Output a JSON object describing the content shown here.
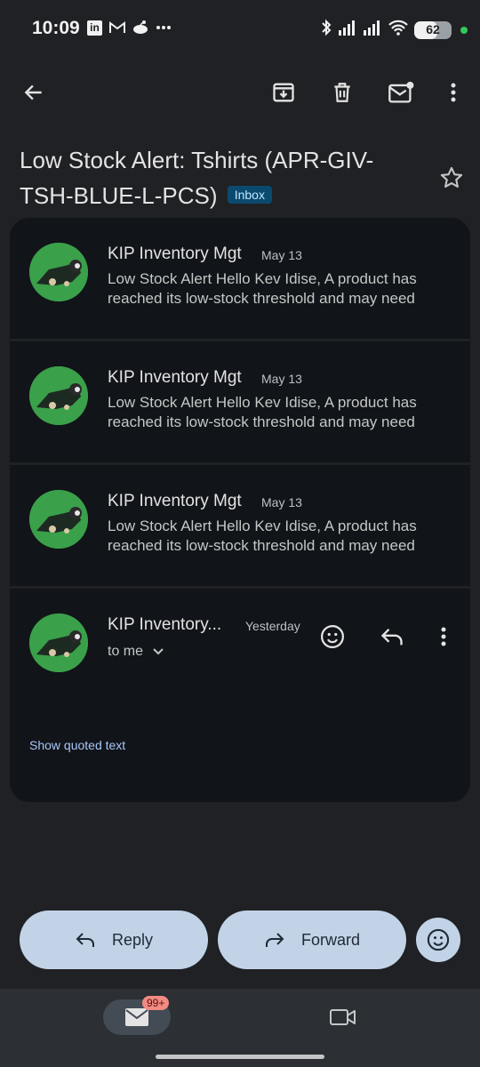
{
  "status_bar": {
    "time": "10:09",
    "left_icons": [
      "linkedin-icon",
      "gmail-icon",
      "reddit-icon",
      "more-dots-icon"
    ],
    "right_icons": [
      "bluetooth-icon",
      "signal-icon",
      "signal-icon",
      "wifi-icon"
    ],
    "battery": {
      "level_percent": 62,
      "text": "62"
    }
  },
  "toolbar": {
    "icons": [
      "back-arrow-icon",
      "archive-icon",
      "delete-icon",
      "mark-unread-icon",
      "more-vert-icon"
    ]
  },
  "subject": {
    "text": "Low Stock Alert: Tshirts (APR-GIV-TSH-BLUE-L-PCS)",
    "label": "Inbox"
  },
  "thread": {
    "collapsed": [
      {
        "sender": "KIP Inventory Mgt",
        "date": "May 13",
        "snippet": "Low Stock Alert Hello Kev Idise, A product has reached its low-stock threshold and may need"
      },
      {
        "sender": "KIP Inventory Mgt",
        "date": "May 13",
        "snippet": "Low Stock Alert Hello Kev Idise, A product has reached its low-stock threshold and may need"
      },
      {
        "sender": "KIP Inventory Mgt",
        "date": "May 13",
        "snippet": "Low Stock Alert Hello Kev Idise, A product has reached its low-stock threshold and may need"
      }
    ],
    "expanded": {
      "sender": "KIP Inventory...",
      "date": "Yesterday",
      "recipient": "to me",
      "show_quoted": "Show quoted text"
    }
  },
  "actions": {
    "reply": "Reply",
    "forward": "Forward"
  },
  "nav": {
    "mail_badge": "99+"
  },
  "colors": {
    "background": "#202124",
    "card": "#111418",
    "pill": "#c2d3e7",
    "avatar": "#3aa04a",
    "link": "#a8c7fa"
  }
}
